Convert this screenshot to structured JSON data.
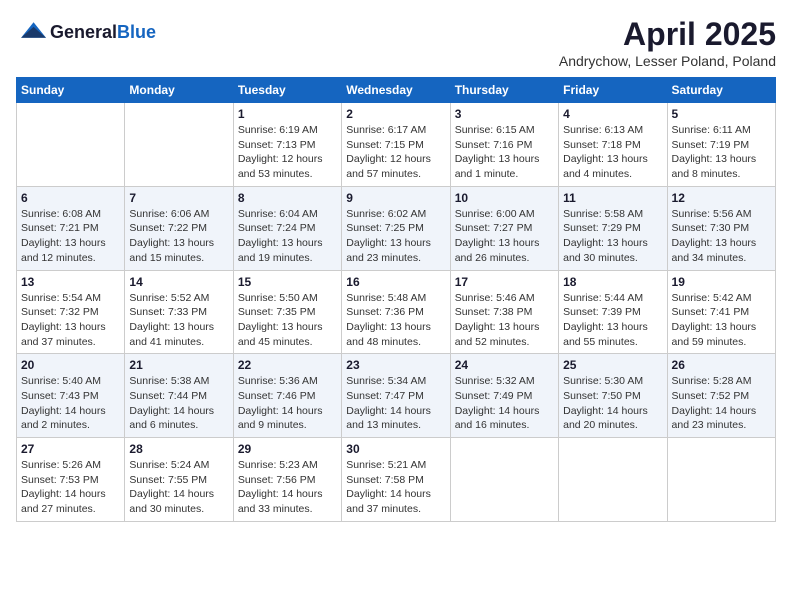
{
  "header": {
    "logo_line1": "General",
    "logo_line2": "Blue",
    "month": "April 2025",
    "location": "Andrychow, Lesser Poland, Poland"
  },
  "weekdays": [
    "Sunday",
    "Monday",
    "Tuesday",
    "Wednesday",
    "Thursday",
    "Friday",
    "Saturday"
  ],
  "weeks": [
    [
      {
        "day": "",
        "info": ""
      },
      {
        "day": "",
        "info": ""
      },
      {
        "day": "1",
        "info": "Sunrise: 6:19 AM\nSunset: 7:13 PM\nDaylight: 12 hours\nand 53 minutes."
      },
      {
        "day": "2",
        "info": "Sunrise: 6:17 AM\nSunset: 7:15 PM\nDaylight: 12 hours\nand 57 minutes."
      },
      {
        "day": "3",
        "info": "Sunrise: 6:15 AM\nSunset: 7:16 PM\nDaylight: 13 hours\nand 1 minute."
      },
      {
        "day": "4",
        "info": "Sunrise: 6:13 AM\nSunset: 7:18 PM\nDaylight: 13 hours\nand 4 minutes."
      },
      {
        "day": "5",
        "info": "Sunrise: 6:11 AM\nSunset: 7:19 PM\nDaylight: 13 hours\nand 8 minutes."
      }
    ],
    [
      {
        "day": "6",
        "info": "Sunrise: 6:08 AM\nSunset: 7:21 PM\nDaylight: 13 hours\nand 12 minutes."
      },
      {
        "day": "7",
        "info": "Sunrise: 6:06 AM\nSunset: 7:22 PM\nDaylight: 13 hours\nand 15 minutes."
      },
      {
        "day": "8",
        "info": "Sunrise: 6:04 AM\nSunset: 7:24 PM\nDaylight: 13 hours\nand 19 minutes."
      },
      {
        "day": "9",
        "info": "Sunrise: 6:02 AM\nSunset: 7:25 PM\nDaylight: 13 hours\nand 23 minutes."
      },
      {
        "day": "10",
        "info": "Sunrise: 6:00 AM\nSunset: 7:27 PM\nDaylight: 13 hours\nand 26 minutes."
      },
      {
        "day": "11",
        "info": "Sunrise: 5:58 AM\nSunset: 7:29 PM\nDaylight: 13 hours\nand 30 minutes."
      },
      {
        "day": "12",
        "info": "Sunrise: 5:56 AM\nSunset: 7:30 PM\nDaylight: 13 hours\nand 34 minutes."
      }
    ],
    [
      {
        "day": "13",
        "info": "Sunrise: 5:54 AM\nSunset: 7:32 PM\nDaylight: 13 hours\nand 37 minutes."
      },
      {
        "day": "14",
        "info": "Sunrise: 5:52 AM\nSunset: 7:33 PM\nDaylight: 13 hours\nand 41 minutes."
      },
      {
        "day": "15",
        "info": "Sunrise: 5:50 AM\nSunset: 7:35 PM\nDaylight: 13 hours\nand 45 minutes."
      },
      {
        "day": "16",
        "info": "Sunrise: 5:48 AM\nSunset: 7:36 PM\nDaylight: 13 hours\nand 48 minutes."
      },
      {
        "day": "17",
        "info": "Sunrise: 5:46 AM\nSunset: 7:38 PM\nDaylight: 13 hours\nand 52 minutes."
      },
      {
        "day": "18",
        "info": "Sunrise: 5:44 AM\nSunset: 7:39 PM\nDaylight: 13 hours\nand 55 minutes."
      },
      {
        "day": "19",
        "info": "Sunrise: 5:42 AM\nSunset: 7:41 PM\nDaylight: 13 hours\nand 59 minutes."
      }
    ],
    [
      {
        "day": "20",
        "info": "Sunrise: 5:40 AM\nSunset: 7:43 PM\nDaylight: 14 hours\nand 2 minutes."
      },
      {
        "day": "21",
        "info": "Sunrise: 5:38 AM\nSunset: 7:44 PM\nDaylight: 14 hours\nand 6 minutes."
      },
      {
        "day": "22",
        "info": "Sunrise: 5:36 AM\nSunset: 7:46 PM\nDaylight: 14 hours\nand 9 minutes."
      },
      {
        "day": "23",
        "info": "Sunrise: 5:34 AM\nSunset: 7:47 PM\nDaylight: 14 hours\nand 13 minutes."
      },
      {
        "day": "24",
        "info": "Sunrise: 5:32 AM\nSunset: 7:49 PM\nDaylight: 14 hours\nand 16 minutes."
      },
      {
        "day": "25",
        "info": "Sunrise: 5:30 AM\nSunset: 7:50 PM\nDaylight: 14 hours\nand 20 minutes."
      },
      {
        "day": "26",
        "info": "Sunrise: 5:28 AM\nSunset: 7:52 PM\nDaylight: 14 hours\nand 23 minutes."
      }
    ],
    [
      {
        "day": "27",
        "info": "Sunrise: 5:26 AM\nSunset: 7:53 PM\nDaylight: 14 hours\nand 27 minutes."
      },
      {
        "day": "28",
        "info": "Sunrise: 5:24 AM\nSunset: 7:55 PM\nDaylight: 14 hours\nand 30 minutes."
      },
      {
        "day": "29",
        "info": "Sunrise: 5:23 AM\nSunset: 7:56 PM\nDaylight: 14 hours\nand 33 minutes."
      },
      {
        "day": "30",
        "info": "Sunrise: 5:21 AM\nSunset: 7:58 PM\nDaylight: 14 hours\nand 37 minutes."
      },
      {
        "day": "",
        "info": ""
      },
      {
        "day": "",
        "info": ""
      },
      {
        "day": "",
        "info": ""
      }
    ]
  ]
}
